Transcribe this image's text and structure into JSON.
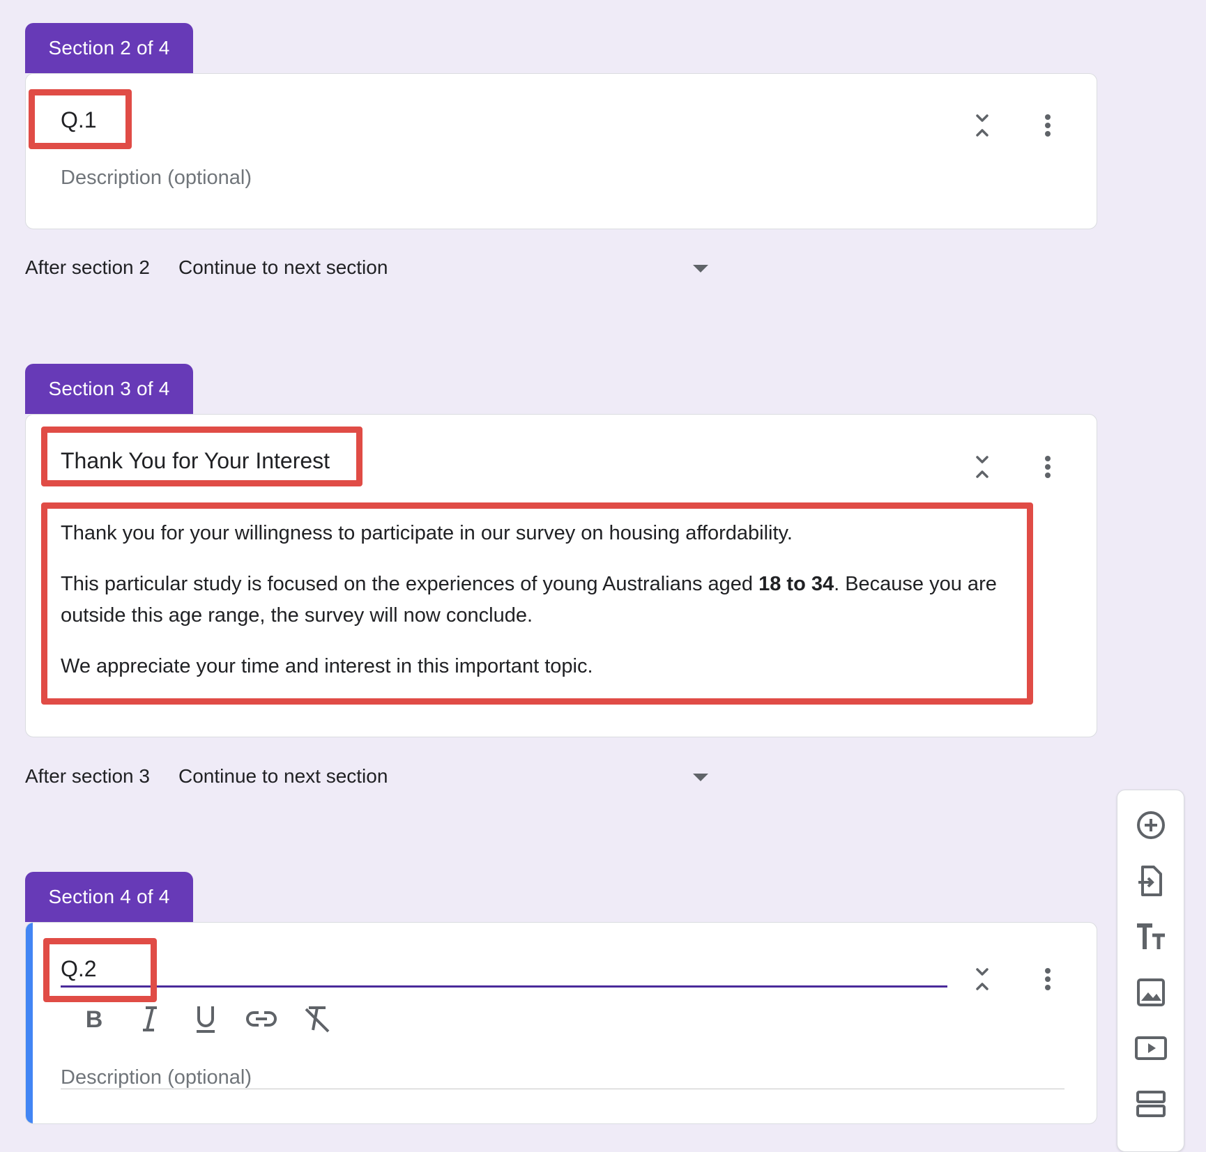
{
  "sections": [
    {
      "tab_label": "Section 2 of 4",
      "title": "Q.1",
      "description_placeholder": "Description (optional)",
      "after_label": "After section 2",
      "after_value": "Continue to next section"
    },
    {
      "tab_label": "Section 3 of 4",
      "title": "Thank You for Your Interest",
      "description": {
        "p1": "Thank you for your willingness to participate in our survey on housing affordability.",
        "p2_before": "This particular study is focused on the experiences of young Australians aged ",
        "p2_bold": "18 to 34",
        "p2_after": ". Because you are outside this age range, the survey will now conclude.",
        "p3": "We appreciate your time and interest in this important topic."
      },
      "after_label": "After section 3",
      "after_value": "Continue to next section"
    },
    {
      "tab_label": "Section 4 of 4",
      "title": "Q.2",
      "description_placeholder": "Description (optional)"
    }
  ],
  "format_toolbar": [
    "bold-icon",
    "italic-icon",
    "underline-icon",
    "link-icon",
    "clear-format-icon"
  ],
  "side_toolbar": [
    "add-question-icon",
    "import-questions-icon",
    "add-title-icon",
    "add-image-icon",
    "add-video-icon",
    "add-section-icon"
  ],
  "colors": {
    "accent": "#673ab7",
    "highlight": "#e04c46",
    "active_bar": "#4285f4",
    "background": "#efebf7"
  }
}
